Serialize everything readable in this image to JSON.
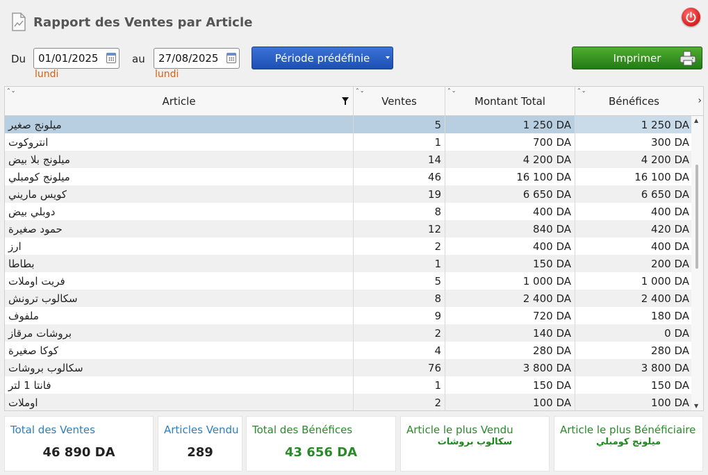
{
  "header": {
    "title": "Rapport des Ventes par Article"
  },
  "icons": {
    "report": "report-doc-icon",
    "power": "power-icon",
    "calendar": "calendar-icon",
    "printer": "printer-icon",
    "filter": "filter-icon"
  },
  "colors": {
    "accent_blue": "#2a7fc0",
    "accent_green": "#2a8a2a",
    "selected_row": "#b7cfe0",
    "day_orange": "#d9600f"
  },
  "filters": {
    "du_label": "Du",
    "du_value": "01/01/2025",
    "du_day": "lundi",
    "au_label": "au",
    "au_value": "27/08/2025",
    "au_day": "lundi",
    "period_button": "Période prédéfinie",
    "print_button": "Imprimer"
  },
  "table": {
    "columns": {
      "article": "Article",
      "ventes": "Ventes",
      "montant": "Montant Total",
      "benefices": "Bénéfices"
    },
    "rows": [
      {
        "article": "ميلونج صغير",
        "ventes": "5",
        "montant": "1 250 DA",
        "benefices": "1 250 DA"
      },
      {
        "article": "انتروكوت",
        "ventes": "1",
        "montant": "700 DA",
        "benefices": "300 DA"
      },
      {
        "article": "ميلونج بلا بيض",
        "ventes": "14",
        "montant": "4 200 DA",
        "benefices": "4 200 DA"
      },
      {
        "article": "ميلونج كومبلي",
        "ventes": "46",
        "montant": "16 100 DA",
        "benefices": "16 100 DA"
      },
      {
        "article": "كويس ماريني",
        "ventes": "19",
        "montant": "6 650 DA",
        "benefices": "6 650 DA"
      },
      {
        "article": "دوبلي بيض",
        "ventes": "8",
        "montant": "400 DA",
        "benefices": "400 DA"
      },
      {
        "article": "حمود صغيرة",
        "ventes": "12",
        "montant": "840 DA",
        "benefices": "420 DA"
      },
      {
        "article": "ارز",
        "ventes": "2",
        "montant": "400 DA",
        "benefices": "400 DA"
      },
      {
        "article": "بطاطا",
        "ventes": "1",
        "montant": "150 DA",
        "benefices": "200 DA"
      },
      {
        "article": "فريت اوملات",
        "ventes": "5",
        "montant": "1 000 DA",
        "benefices": "1 000 DA"
      },
      {
        "article": "سكالوب ترونش",
        "ventes": "8",
        "montant": "2 400 DA",
        "benefices": "2 400 DA"
      },
      {
        "article": "ملفوف",
        "ventes": "9",
        "montant": "720 DA",
        "benefices": "180 DA"
      },
      {
        "article": "بروشات مرقاز",
        "ventes": "2",
        "montant": "140 DA",
        "benefices": "0 DA"
      },
      {
        "article": "كوكا صغيرة",
        "ventes": "4",
        "montant": "280 DA",
        "benefices": "280 DA"
      },
      {
        "article": "سكالوب بروشات",
        "ventes": "76",
        "montant": "3 800 DA",
        "benefices": "3 800 DA"
      },
      {
        "article": "فانتا 1 لتر",
        "ventes": "1",
        "montant": "150 DA",
        "benefices": "150 DA"
      },
      {
        "article": "اوملات",
        "ventes": "2",
        "montant": "100 DA",
        "benefices": "100 DA"
      }
    ]
  },
  "summary": {
    "total_ventes_label": "Total des Ventes",
    "total_ventes_value": "46 890 DA",
    "articles_vendu_label": "Articles Vendu",
    "articles_vendu_value": "289",
    "total_benefices_label": "Total des Bénéfices",
    "total_benefices_value": "43 656 DA",
    "plus_vendu_label": "Article le plus Vendu",
    "plus_vendu_value": "سكالوب بروشات",
    "plus_benef_label": "Article le plus Bénéficiaire",
    "plus_benef_value": "ميلونج كومبلي"
  }
}
